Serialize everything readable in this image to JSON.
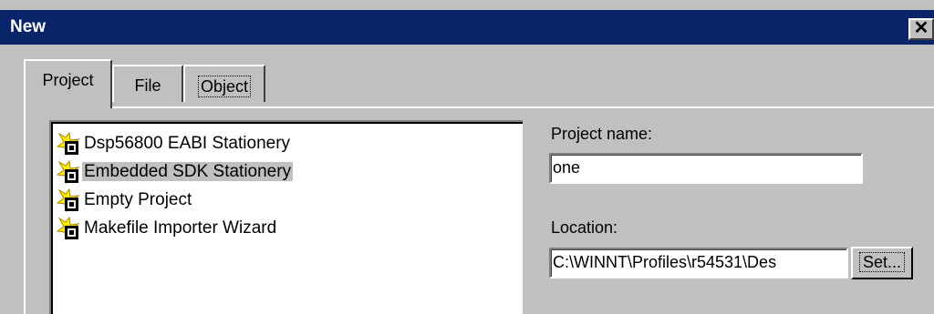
{
  "window": {
    "title": "New",
    "close_glyph": "✕",
    "titlebar_color": "#0a246a",
    "face_color": "#c0c0c0"
  },
  "tabs": [
    {
      "label": "Project",
      "active": true
    },
    {
      "label": "File",
      "active": false
    },
    {
      "label": "Object",
      "active": false
    }
  ],
  "project_list": {
    "items": [
      {
        "label": "Dsp56800 EABI Stationery",
        "icon": "project-stationery-icon",
        "selected": false
      },
      {
        "label": "Embedded SDK Stationery",
        "icon": "project-stationery-icon",
        "selected": true
      },
      {
        "label": "Empty Project",
        "icon": "project-stationery-icon",
        "selected": false
      },
      {
        "label": "Makefile Importer Wizard",
        "icon": "project-stationery-icon",
        "selected": false
      }
    ]
  },
  "form": {
    "project_name_label": "Project name:",
    "project_name_value": "one",
    "location_label": "Location:",
    "location_value": "C:\\WINNT\\Profiles\\r54531\\Des",
    "set_button_label": "Set..."
  }
}
